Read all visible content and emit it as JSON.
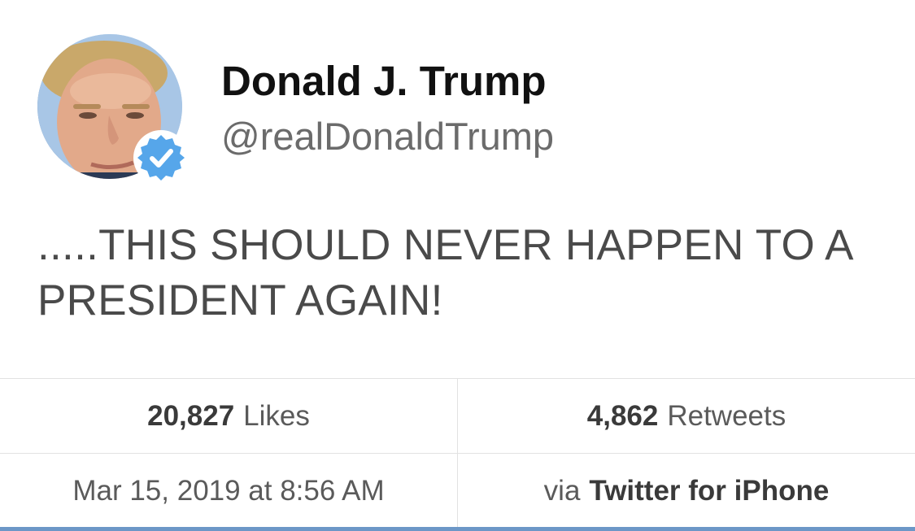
{
  "author": {
    "name": "Donald J. Trump",
    "handle": "@realDonaldTrump",
    "verified": true
  },
  "tweet": {
    "text": ".....THIS SHOULD NEVER HAPPEN TO A PRESIDENT AGAIN!"
  },
  "stats": {
    "likes_count": "20,827",
    "likes_label": "Likes",
    "retweets_count": "4,862",
    "retweets_label": "Retweets"
  },
  "meta": {
    "timestamp": "Mar 15, 2019 at 8:56 AM",
    "via_label": "via",
    "source": "Twitter for iPhone"
  },
  "colors": {
    "verified_badge": "#56a6ea",
    "accent_bar": "#6c97c7"
  }
}
